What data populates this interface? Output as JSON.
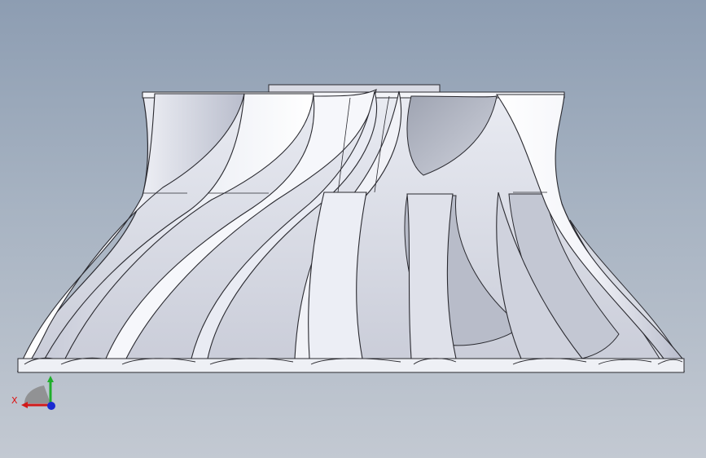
{
  "view": {
    "background_top": "#8d9db2",
    "background_bottom": "#c3c9d2"
  },
  "model": {
    "type": "impeller-3d-render",
    "blade_color": "#f2f3f8",
    "shade_color": "#a9aebf",
    "edge_color": "#2a2a30"
  },
  "triad": {
    "x_label": "X",
    "x_color": "#d11a1a",
    "y_color": "#1fae2b",
    "z_color": "#1a2ad1",
    "plane_color": "#8a8a8a"
  }
}
